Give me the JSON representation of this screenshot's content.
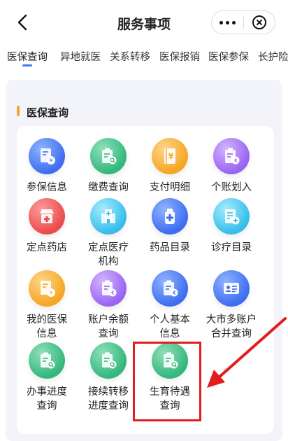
{
  "header": {
    "title": "服务事项"
  },
  "tabs": [
    {
      "label": "医保查询"
    },
    {
      "label": "异地就医"
    },
    {
      "label": "关系转移"
    },
    {
      "label": "医保报销"
    },
    {
      "label": "医保参保"
    },
    {
      "label": "长护险"
    }
  ],
  "section": {
    "title": "医保查询"
  },
  "services": [
    {
      "line1": "参保信息",
      "line2": "",
      "icon": "document-yuan-icon",
      "color": "#3d6df0"
    },
    {
      "line1": "缴费查询",
      "line2": "",
      "icon": "clipboard-search-icon",
      "color": "#33b77d"
    },
    {
      "line1": "支付明细",
      "line2": "",
      "icon": "ledger-yuan-icon",
      "color": "#f5a623"
    },
    {
      "line1": "个账划入",
      "line2": "",
      "icon": "clipboard-transfer-icon",
      "color": "#9a63f2"
    },
    {
      "line1": "定点药店",
      "line2": "",
      "icon": "pharmacy-store-icon",
      "color": "#ea4b4b"
    },
    {
      "line1": "定点医疗",
      "line2": "机构",
      "icon": "hospital-icon",
      "color": "#36bde8"
    },
    {
      "line1": "药品目录",
      "line2": "",
      "icon": "medicine-bottle-icon",
      "color": "#3d6df0"
    },
    {
      "line1": "诊疗目录",
      "line2": "",
      "icon": "medical-list-icon",
      "color": "#36bde8"
    },
    {
      "line1": "我的医保",
      "line2": "信息",
      "icon": "document-yuan-icon",
      "color": "#f5a623"
    },
    {
      "line1": "账户余额",
      "line2": "查询",
      "icon": "clipboard-transfer-icon",
      "color": "#9a63f2"
    },
    {
      "line1": "个人基本",
      "line2": "信息",
      "icon": "clipboard-transfer-icon",
      "color": "#3d6df0"
    },
    {
      "line1": "大市多账户",
      "line2": "合并查询",
      "icon": "id-card-icon",
      "color": "#3d6df0"
    },
    {
      "line1": "办事进度",
      "line2": "查询",
      "icon": "clipboard-search-icon",
      "color": "#33b77d"
    },
    {
      "line1": "接续转移",
      "line2": "进度查询",
      "icon": "clipboard-search-icon",
      "color": "#33b77d"
    },
    {
      "line1": "生育待遇",
      "line2": "查询",
      "icon": "clipboard-search-icon",
      "color": "#33b77d"
    }
  ],
  "annotation": {
    "highlight_color": "#e11d1d"
  }
}
